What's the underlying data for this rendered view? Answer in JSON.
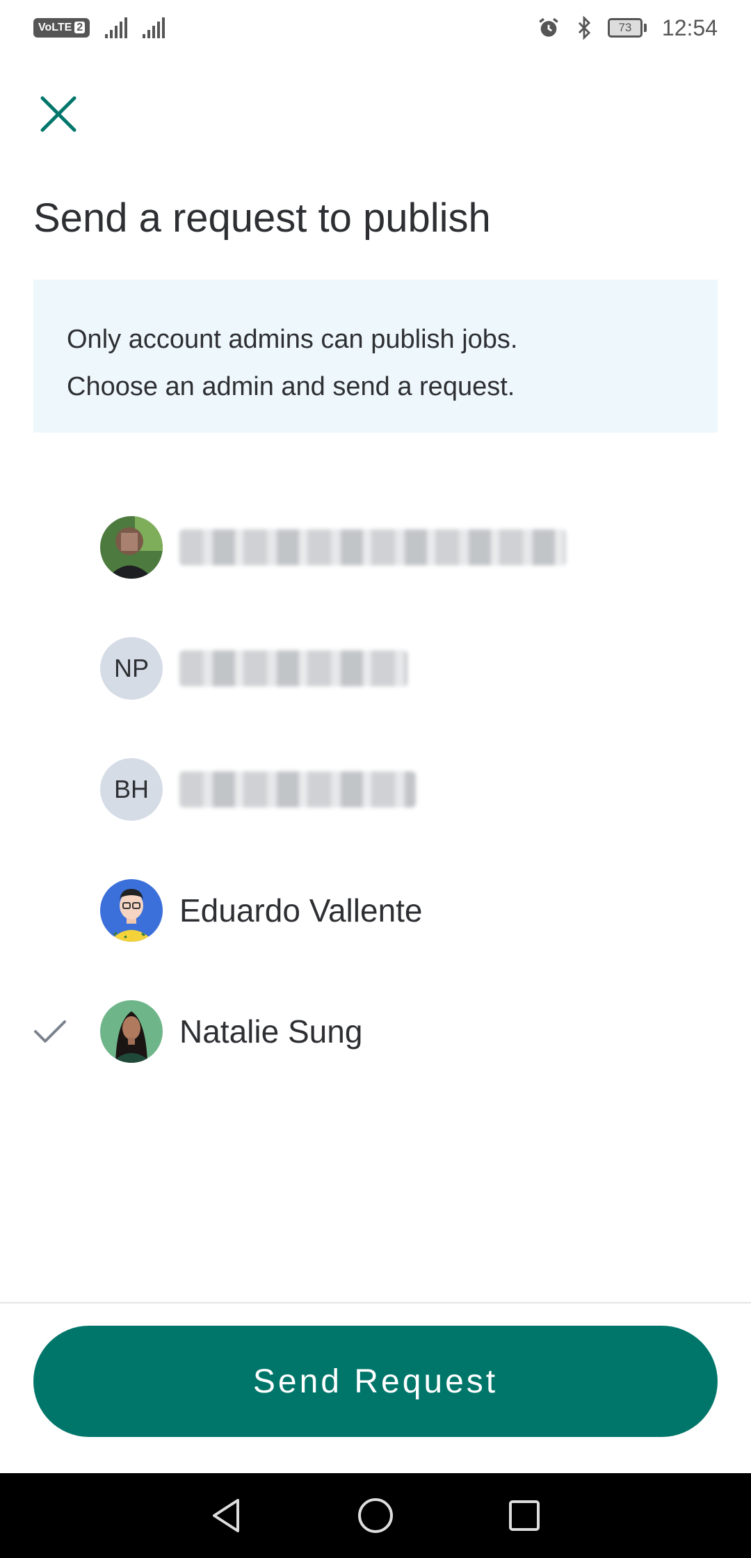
{
  "status_bar": {
    "volte": "VoLTE",
    "sim": "2",
    "battery": "73",
    "time": "12:54"
  },
  "header": {
    "title": "Send a request to publish"
  },
  "info": {
    "line1": "Only account admins can publish jobs.",
    "line2": "Choose an admin and send a request."
  },
  "admins": [
    {
      "name": "",
      "initials": "",
      "avatar": "photo-avatar",
      "blurred": true,
      "selected": false
    },
    {
      "name": "",
      "initials": "NP",
      "avatar": "initials",
      "blurred": true,
      "selected": false
    },
    {
      "name": "",
      "initials": "BH",
      "avatar": "initials",
      "blurred": true,
      "selected": false
    },
    {
      "name": "Eduardo Vallente",
      "initials": "",
      "avatar": "illustrated-avatar-blue",
      "blurred": false,
      "selected": false
    },
    {
      "name": "Natalie Sung",
      "initials": "",
      "avatar": "illustrated-avatar-green",
      "blurred": false,
      "selected": true
    }
  ],
  "footer": {
    "send_label": "Send Request"
  },
  "colors": {
    "accent": "#00766a",
    "info_bg": "#eef7fb",
    "initials_bg": "#d5dce6"
  }
}
